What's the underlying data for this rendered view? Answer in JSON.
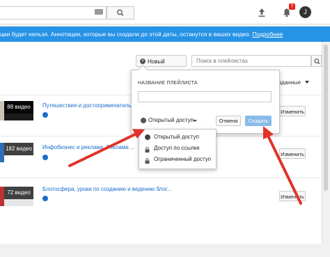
{
  "topbar": {
    "search_icon": "search-icon",
    "upload_icon": "upload-icon",
    "bell_icon": "bell-icon",
    "notification_count": "7",
    "avatar_letter": "J"
  },
  "banner": {
    "text": "ции будет нельзя. Аннотации, которые вы создали до этой даты, останутся в ваших видео.",
    "link": "Подробнее"
  },
  "toolbar": {
    "new_playlist_label": "Новый плейлист",
    "search_placeholder": "Поиск в плейлистах",
    "sort_label": "созданные"
  },
  "playlists": [
    {
      "count": "88 видео",
      "title": "Путешествия и достопримечатель",
      "change_label": "Изменить"
    },
    {
      "count": "182 видео",
      "title": "Инфобизнес и реклама. Реклама ...",
      "change_label": "Изменить"
    },
    {
      "count": "72 видео",
      "title": "Блогосфера, уроки по созданию и ведению блог...",
      "change_label": "Изменить"
    }
  ],
  "popup": {
    "name_label": "НАЗВАНИЕ ПЛЕЙЛИСТА",
    "name_value": "",
    "privacy_label": "Открытый доступ",
    "cancel_label": "Отмена",
    "create_label": "Создать"
  },
  "privacy_menu": {
    "items": [
      {
        "label": "Открытый доступ",
        "icon": "globe-icon"
      },
      {
        "label": "Доступ по ссылке",
        "icon": "lock-icon"
      },
      {
        "label": "Ограниченный доступ",
        "icon": "lock-icon"
      }
    ]
  },
  "colors": {
    "banner": "#2793e6",
    "link": "#1a6dcc",
    "create_button": "#89bbe9",
    "arrow": "#e0332a"
  }
}
